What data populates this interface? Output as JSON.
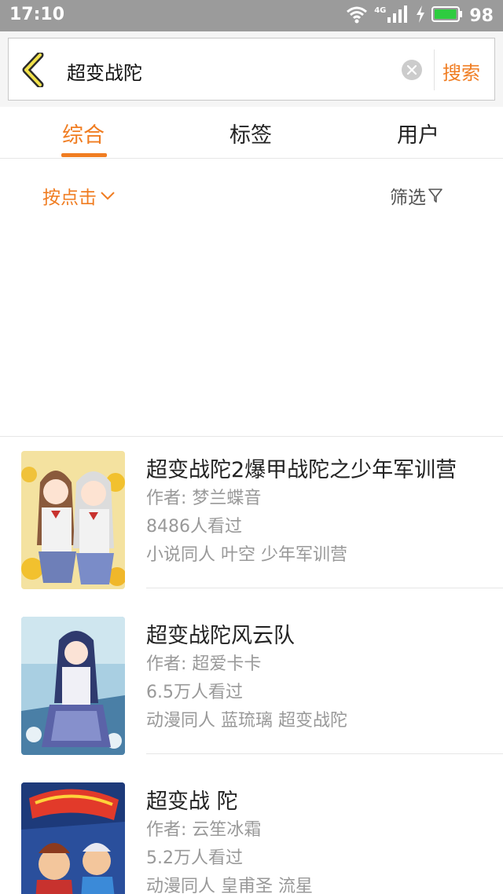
{
  "status_bar": {
    "time": "17:10",
    "network": "4G",
    "battery_percent": "98",
    "battery_level": 0.98,
    "icons": [
      "wifi-icon",
      "signal-icon",
      "charging-icon",
      "battery-icon"
    ]
  },
  "search": {
    "query": "超变战陀",
    "search_label": "搜索",
    "icons": [
      "back-icon",
      "clear-icon"
    ]
  },
  "tabs": [
    {
      "label": "综合",
      "active": true
    },
    {
      "label": "标签",
      "active": false
    },
    {
      "label": "用户",
      "active": false
    }
  ],
  "filters": {
    "sort_label": "按点击",
    "filter_label": "筛选",
    "icons": [
      "chevron-down-icon",
      "funnel-icon"
    ]
  },
  "results": [
    {
      "title": "超变战陀2爆甲战陀之少年军训营",
      "author": "作者: 梦兰蝶音",
      "views": "8486人看过",
      "tags": "小说同人 叶空 少年军训营"
    },
    {
      "title": "超变战陀风云队",
      "author": "作者: 超爱卡卡",
      "views": "6.5万人看过",
      "tags": "动漫同人 蓝琉璃 超变战陀"
    },
    {
      "title": "超变战 陀",
      "author": "作者: 云笙冰霜",
      "views": "5.2万人看过",
      "tags": "动漫同人 皇甫圣 流星"
    }
  ],
  "colors": {
    "accent": "#f07d22",
    "status_bar": "#9b9b9b",
    "battery": "#2ecc40",
    "secondary_text": "#999999"
  }
}
